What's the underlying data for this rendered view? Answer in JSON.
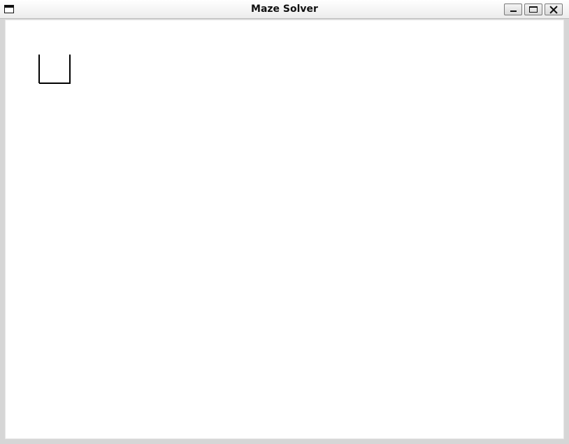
{
  "window": {
    "title": "Maze Solver"
  },
  "controls": {
    "minimize": "minimize-icon",
    "maximize": "maximize-icon",
    "close": "close-icon"
  },
  "maze": {
    "wall_color": "#000000",
    "cell": {
      "walls": [
        "left",
        "bottom",
        "right"
      ]
    }
  }
}
